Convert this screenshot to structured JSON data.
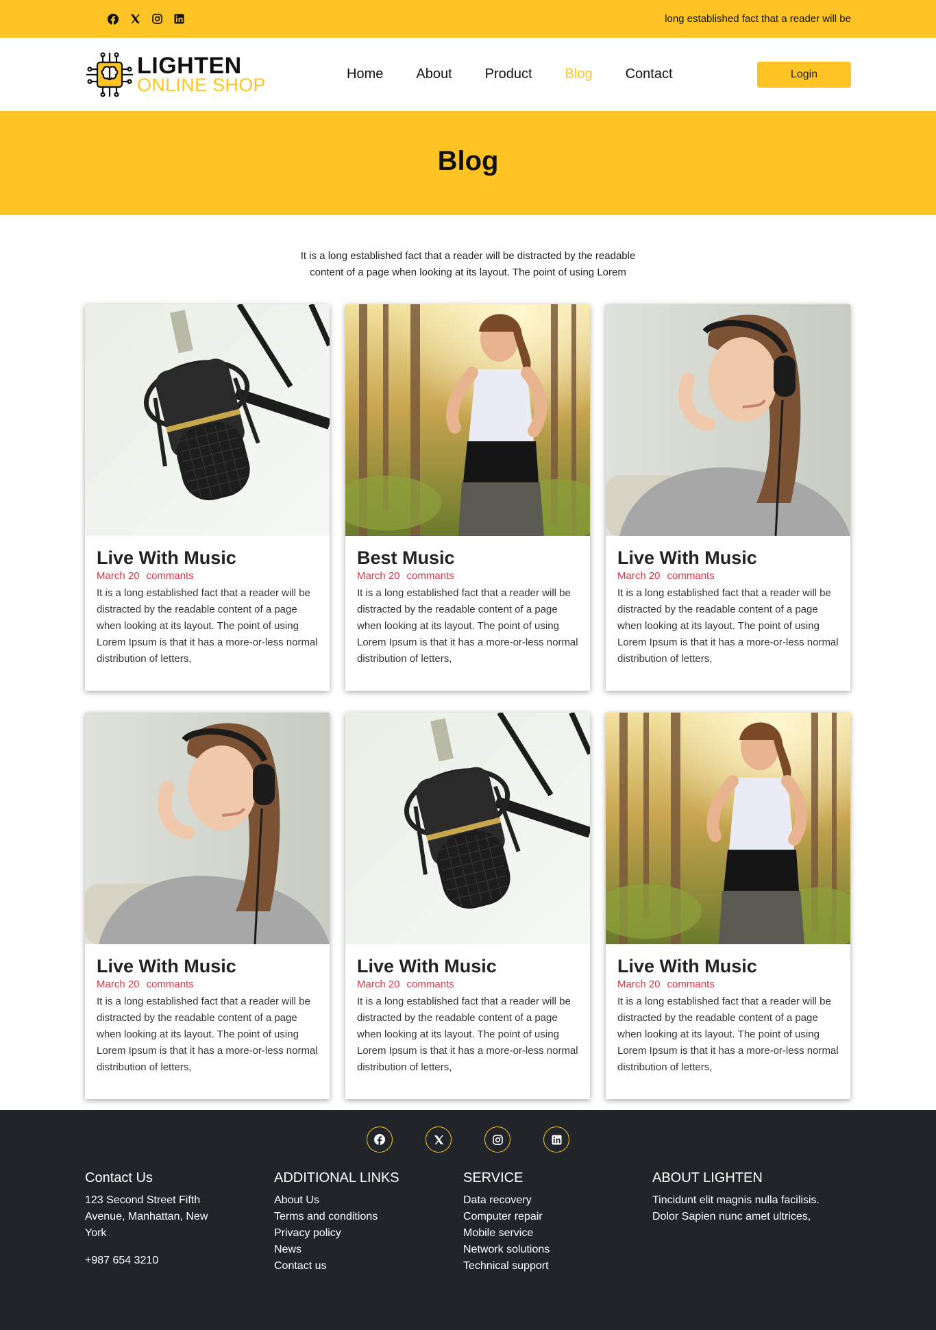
{
  "topbar": {
    "social_icons": [
      "facebook-icon",
      "x-twitter-icon",
      "instagram-icon",
      "linkedin-icon"
    ],
    "text": "long established fact that a reader will be"
  },
  "header": {
    "logo_title": "LIGHTEN",
    "logo_subtitle": "ONLINE SHOP",
    "nav": [
      {
        "label": "Home",
        "active": false
      },
      {
        "label": "About",
        "active": false
      },
      {
        "label": "Product",
        "active": false
      },
      {
        "label": "Blog",
        "active": true
      },
      {
        "label": "Contact",
        "active": false
      }
    ],
    "login_label": "Login"
  },
  "hero": {
    "title": "Blog"
  },
  "intro": "It is a long established fact that a reader will be distracted by the readable content of a page when looking at its layout. The point of using Lorem",
  "posts": [
    {
      "image": "microphone",
      "title": "Live With Music",
      "date": "March 20",
      "comments": "commants",
      "text": "It is a long established fact that a reader will be distracted by the readable content of a page when looking at its layout. The point of using Lorem Ipsum is that it has a more-or-less normal distribution of letters,"
    },
    {
      "image": "runner",
      "title": "Best Music",
      "date": "March 20",
      "comments": "commants",
      "text": "It is a long established fact that a reader will be distracted by the readable content of a page when looking at its layout. The point of using Lorem Ipsum is that it has a more-or-less normal distribution of letters,"
    },
    {
      "image": "headphones-woman",
      "title": "Live With Music",
      "date": "March 20",
      "comments": "commants",
      "text": "It is a long established fact that a reader will be distracted by the readable content of a page when looking at its layout. The point of using Lorem Ipsum is that it has a more-or-less normal distribution of letters,"
    },
    {
      "image": "headphones-woman",
      "title": "Live With Music",
      "date": "March 20",
      "comments": "commants",
      "text": "It is a long established fact that a reader will be distracted by the readable content of a page when looking at its layout. The point of using Lorem Ipsum is that it has a more-or-less normal distribution of letters,"
    },
    {
      "image": "microphone",
      "title": "Live With Music",
      "date": "March 20",
      "comments": "commants",
      "text": "It is a long established fact that a reader will be distracted by the readable content of a page when looking at its layout. The point of using Lorem Ipsum is that it has a more-or-less normal distribution of letters,"
    },
    {
      "image": "runner",
      "title": "Live With Music",
      "date": "March 20",
      "comments": "commants",
      "text": "It is a long established fact that a reader will be distracted by the readable content of a page when looking at its layout. The point of using Lorem Ipsum is that it has a more-or-less normal distribution of letters,"
    }
  ],
  "footer": {
    "social_icons": [
      "facebook-icon",
      "x-twitter-icon",
      "instagram-icon",
      "linkedin-icon"
    ],
    "contact": {
      "heading": "Contact Us",
      "address": "123 Second Street Fifth Avenue, Manhattan, New York",
      "phone": "+987 654 3210"
    },
    "links": {
      "heading": "ADDITIONAL LINKS",
      "items": [
        "About Us",
        "Terms and conditions",
        "Privacy policy",
        "News",
        "Contact us"
      ]
    },
    "service": {
      "heading": "SERVICE",
      "items": [
        "Data recovery",
        "Computer repair",
        "Mobile service",
        "Network solutions",
        "Technical support"
      ]
    },
    "about": {
      "heading": "ABOUT LIGHTEN",
      "text": "Tincidunt elit magnis nulla facilisis. Dolor Sapien nunc amet ultrices,"
    }
  },
  "colors": {
    "accent": "#fec424",
    "meta": "#dc3545",
    "footer_bg": "#212529"
  }
}
